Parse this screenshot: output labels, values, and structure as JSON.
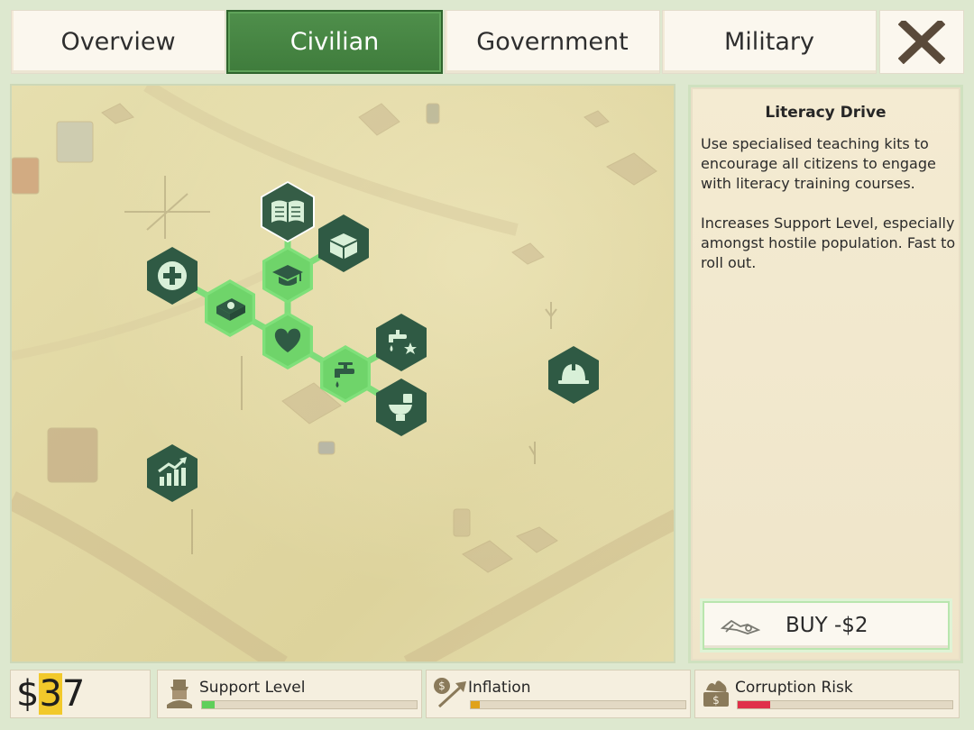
{
  "tabs": [
    {
      "label": "Overview",
      "active": false
    },
    {
      "label": "Civilian",
      "active": true
    },
    {
      "label": "Government",
      "active": false
    },
    {
      "label": "Military",
      "active": false
    }
  ],
  "close_icon": "close-x-icon",
  "panel": {
    "title": "Literacy Drive",
    "paragraph1": "Use specialised teaching kits to encourage all citizens to engage with literacy training courses.",
    "paragraph2": "Increases Support Level, especially amongst hostile population. Fast to roll out.",
    "buy_label": "BUY -$2",
    "buy_icon": "teaching-kit-icon"
  },
  "money": {
    "prefix": "$",
    "highlight": "3",
    "rest": "7"
  },
  "stats": {
    "support": {
      "label": "Support Level",
      "icon": "support-level-icon",
      "level": 0.06,
      "color": "#5fcf5a"
    },
    "inflation": {
      "label": "Inflation",
      "icon": "inflation-icon",
      "level": 0.04,
      "color": "#e0a21a"
    },
    "corruption": {
      "label": "Corruption Risk",
      "icon": "corruption-risk-icon",
      "level": 0.15,
      "color": "#e0304a"
    }
  },
  "policy_nodes": [
    {
      "name": "literacy-drive",
      "icon": "book-icon",
      "state": "selected"
    },
    {
      "name": "aid-box",
      "icon": "box-icon",
      "state": "locked"
    },
    {
      "name": "education",
      "icon": "graduation-cap-icon",
      "state": "unlocked"
    },
    {
      "name": "medical-aid",
      "icon": "medical-cross-icon",
      "state": "locked"
    },
    {
      "name": "first-aid-kit",
      "icon": "first-aid-kit-icon",
      "state": "unlocked"
    },
    {
      "name": "welfare",
      "icon": "heart-icon",
      "state": "unlocked"
    },
    {
      "name": "water-supply",
      "icon": "water-tap-icon",
      "state": "unlocked"
    },
    {
      "name": "clean-water",
      "icon": "tap-star-icon",
      "state": "locked"
    },
    {
      "name": "sanitation",
      "icon": "toilet-icon",
      "state": "locked"
    },
    {
      "name": "construction",
      "icon": "hard-hat-icon",
      "state": "locked"
    },
    {
      "name": "economy",
      "icon": "growth-chart-icon",
      "state": "locked"
    }
  ]
}
